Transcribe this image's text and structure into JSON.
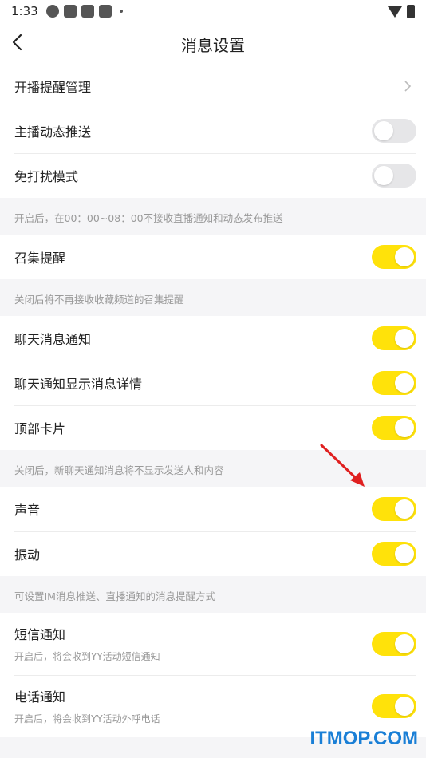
{
  "status_bar": {
    "time": "1:33"
  },
  "header": {
    "title": "消息设置"
  },
  "sections": {
    "s1": {
      "items": [
        {
          "label": "开播提醒管理"
        },
        {
          "label": "主播动态推送",
          "toggle": "off"
        },
        {
          "label": "免打扰模式",
          "toggle": "off"
        }
      ],
      "note": "开启后，在00：00~08：00不接收直播通知和动态发布推送"
    },
    "s2": {
      "items": [
        {
          "label": "召集提醒",
          "toggle": "on"
        }
      ],
      "note": "关闭后将不再接收收藏频道的召集提醒"
    },
    "s3": {
      "items": [
        {
          "label": "聊天消息通知",
          "toggle": "on"
        },
        {
          "label": "聊天通知显示消息详情",
          "toggle": "on"
        },
        {
          "label": "顶部卡片",
          "toggle": "on"
        }
      ],
      "note": "关闭后，新聊天通知消息将不显示发送人和内容"
    },
    "s4": {
      "items": [
        {
          "label": "声音",
          "toggle": "on"
        },
        {
          "label": "振动",
          "toggle": "on"
        }
      ],
      "note": "可设置IM消息推送、直播通知的消息提醒方式"
    },
    "s5": {
      "items": [
        {
          "label": "短信通知",
          "sub": "开启后，将会收到YY活动短信通知",
          "toggle": "on"
        },
        {
          "label": "电话通知",
          "sub": "开启后，将会收到YY活动外呼电话",
          "toggle": "on"
        }
      ]
    }
  },
  "colors": {
    "toggle_on": "#ffe20a",
    "toggle_off": "#e6e6e8",
    "annotation_arrow": "#e02020",
    "watermark": "#1a7fd6"
  },
  "watermark": "ITMOP.COM"
}
